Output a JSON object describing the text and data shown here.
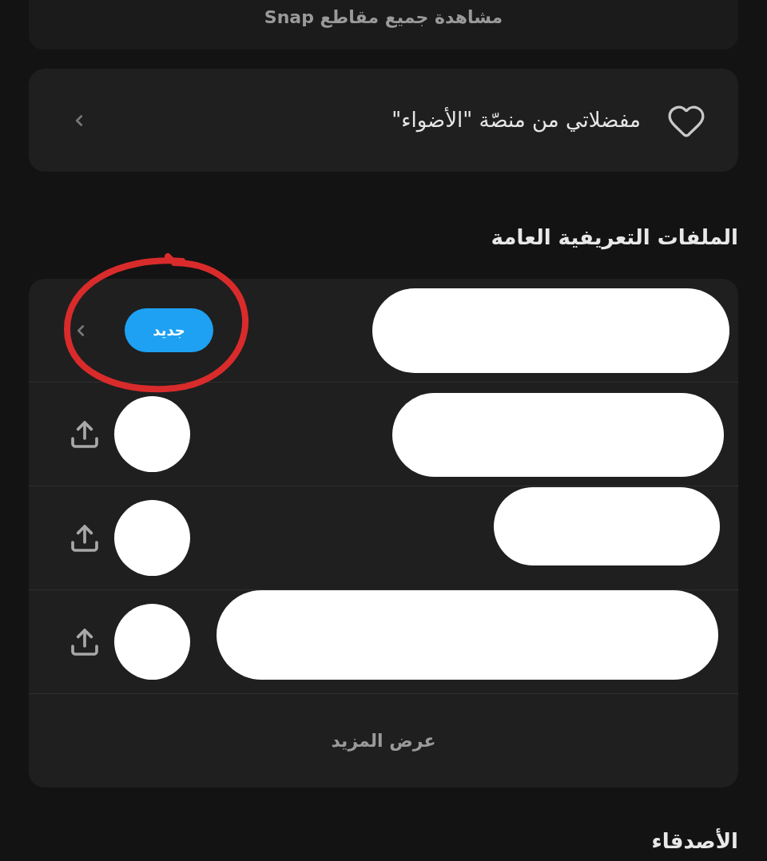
{
  "top_card": {
    "label": "مشاهدة جميع مقاطع Snap"
  },
  "favorites": {
    "label": "مفضلاتي من منصّة \"الأضواء\""
  },
  "public_profiles": {
    "title": "الملفات التعريفية العامة",
    "rows": [
      {
        "kind": "badge",
        "badge": "جديد",
        "redacted": true,
        "highlighted": true
      },
      {
        "kind": "share",
        "redacted": true,
        "highlighted": false
      },
      {
        "kind": "share",
        "redacted": true,
        "highlighted": false
      },
      {
        "kind": "share",
        "redacted": true,
        "highlighted": false
      }
    ],
    "show_more": "عرض المزيد"
  },
  "friends": {
    "title": "الأصدقاء"
  }
}
